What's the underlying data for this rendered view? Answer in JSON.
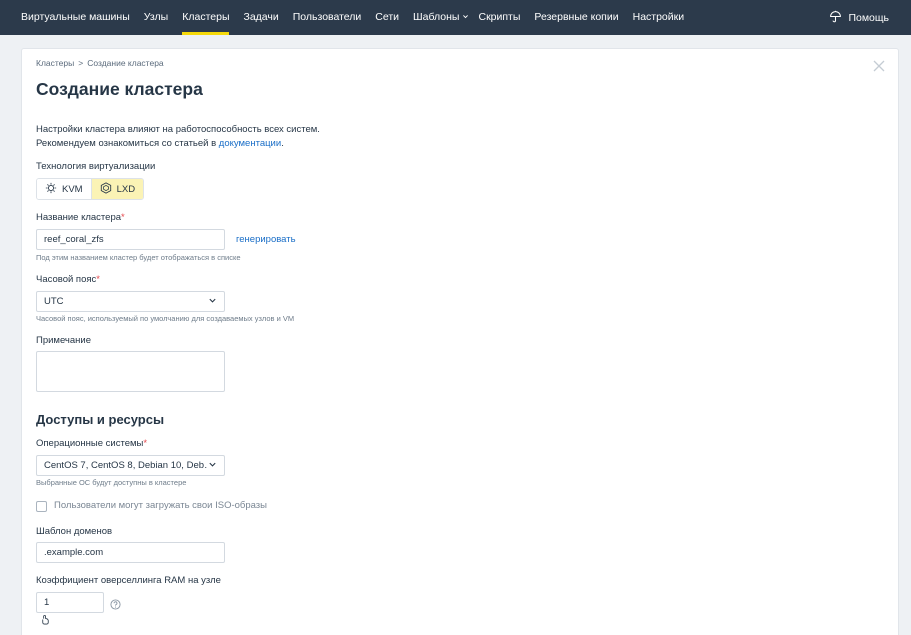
{
  "nav": {
    "items": [
      {
        "label": "Виртуальные машины"
      },
      {
        "label": "Узлы"
      },
      {
        "label": "Кластеры"
      },
      {
        "label": "Задачи"
      },
      {
        "label": "Пользователи"
      },
      {
        "label": "Сети"
      },
      {
        "label": "Шаблоны"
      },
      {
        "label": "Скрипты"
      },
      {
        "label": "Резервные копии"
      },
      {
        "label": "Настройки"
      }
    ],
    "active_index": 2,
    "help_label": "Помощь",
    "accent_color": "#f5d90a",
    "bg_color": "#2c3a4b"
  },
  "breadcrumb": {
    "parent": "Кластеры",
    "separator": ">",
    "current": "Создание кластера"
  },
  "page_title": "Создание кластера",
  "info": {
    "line1": "Настройки кластера влияют на работоспособность всех систем.",
    "line2_prefix": "Рекомендуем ознакомиться со статьей в ",
    "line2_link": "документации",
    "line2_suffix": "."
  },
  "virtualization": {
    "label": "Технология виртуализации",
    "options": [
      {
        "label": "KVM",
        "icon": "kvm-icon",
        "selected": false
      },
      {
        "label": "LXD",
        "icon": "lxd-icon",
        "selected": true
      }
    ]
  },
  "cluster_name": {
    "label": "Название кластера",
    "required_mark": "*",
    "value": "reef_coral_zfs",
    "generate_label": "генерировать",
    "hint": "Под этим названием кластер будет отображаться в списке"
  },
  "timezone": {
    "label": "Часовой пояс",
    "required_mark": "*",
    "value": "UTC",
    "hint": "Часовой пояс, используемый по умолчанию для создаваемых узлов и VM"
  },
  "note": {
    "label": "Примечание",
    "value": ""
  },
  "access_section": {
    "title": "Доступы и ресурсы"
  },
  "os": {
    "label": "Операционные системы",
    "required_mark": "*",
    "value": "CentOS 7, CentOS 8, Debian 10, Deb…",
    "hint": "Выбранные ОС будут доступны в кластере"
  },
  "iso_upload": {
    "label": "Пользователи могут загружать свои ISO-образы",
    "checked": false
  },
  "domain_template": {
    "label": "Шаблон доменов",
    "value": ".example.com"
  },
  "ram_overselling": {
    "label": "Коэффициент оверселлинга RAM на узле",
    "value": "1"
  }
}
